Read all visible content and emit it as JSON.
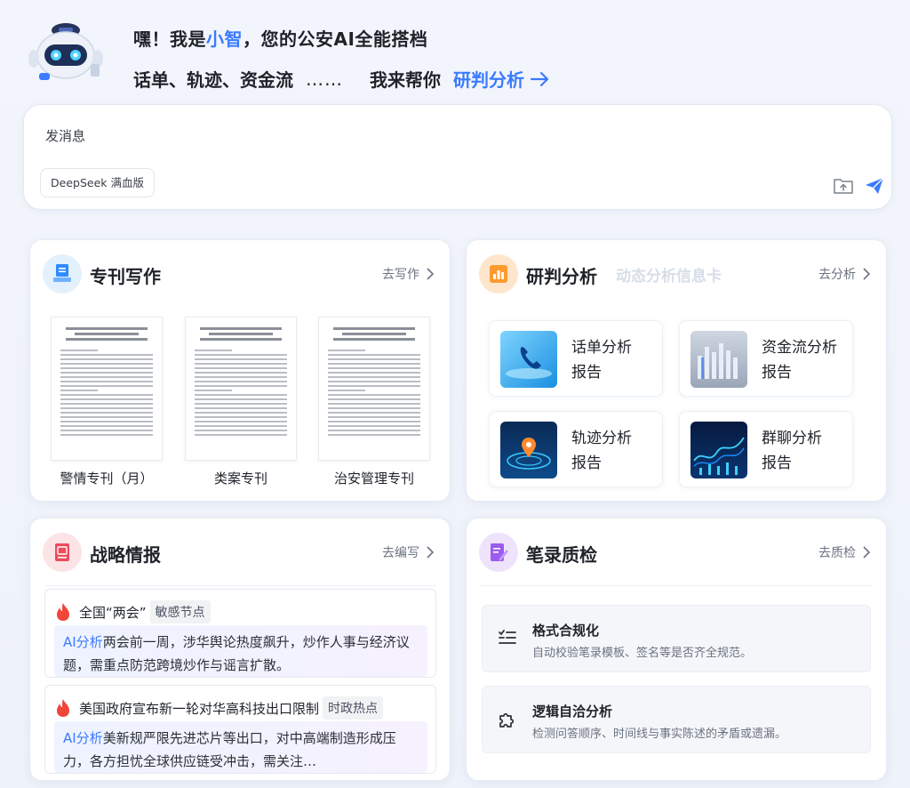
{
  "hero": {
    "greeting_prefix": "嘿！我是",
    "assistant_name": "小智",
    "greeting_suffix": "，您的公安AI全能搭档",
    "topics": "话单、轨迹、资金流",
    "ellipsis": "……",
    "help_text": "我来帮你",
    "link_label": "研判分析"
  },
  "chat": {
    "placeholder": "发消息",
    "model": "DeepSeek 满血版"
  },
  "writing": {
    "title": "专刊写作",
    "more": "去写作",
    "docs": [
      {
        "label": "警情专刊（月）"
      },
      {
        "label": "类案专刊"
      },
      {
        "label": "治安管理专刊"
      }
    ]
  },
  "analysis": {
    "title": "研判分析",
    "bg_text": "动态分析信息卡",
    "more": "去分析",
    "tiles": [
      {
        "line1": "话单分析",
        "line2": "报告"
      },
      {
        "line1": "资金流分析",
        "line2": "报告"
      },
      {
        "line1": "轨迹分析",
        "line2": "报告"
      },
      {
        "line1": "群聊分析",
        "line2": "报告"
      }
    ]
  },
  "intel": {
    "title": "战略情报",
    "more": "去编写",
    "items": [
      {
        "title": "全国“两会”",
        "tag": "敏感节点",
        "ai": "AI分析",
        "body": "两会前一周，涉华舆论热度飙升，炒作人事与经济议题，需重点防范跨境炒作与谣言扩散。"
      },
      {
        "title": "美国政府宣布新一轮对华高科技出口限制",
        "tag": "时政热点",
        "ai": "AI分析",
        "body": "美新规严限先进芯片等出口，对中高端制造形成压力，各方担忧全球供应链受冲击，需关注…"
      }
    ]
  },
  "check": {
    "title": "笔录质检",
    "more": "去质检",
    "items": [
      {
        "title": "格式合规化",
        "desc": "自动校验笔录模板、签名等是否齐全规范。"
      },
      {
        "title": "逻辑自洽分析",
        "desc": "检测问答顺序、时间线与事实陈述的矛盾或遗漏。"
      }
    ]
  },
  "colors": {
    "accent": "#3a7bff",
    "writing_icon_bg": "#e3f1fc",
    "analysis_icon_bg": "#fde6cc",
    "intel_icon_bg": "#fce3e6",
    "check_icon_bg": "#efe3fb"
  }
}
